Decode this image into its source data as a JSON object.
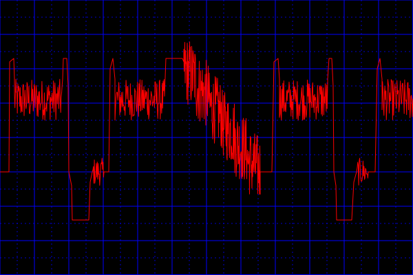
{
  "colors": {
    "background": "#000000",
    "grid_major": "#0000ff",
    "grid_minor": "#0000cc",
    "trace": "#ff0000"
  },
  "chart_data": {
    "type": "line",
    "title": "",
    "xlabel": "",
    "ylabel": "",
    "xlim": [
      0,
      12
    ],
    "ylim": [
      -4,
      4
    ],
    "grid": {
      "major": true,
      "minor_dotted": true,
      "major_x_divisions": 12,
      "major_y_divisions": 8
    },
    "series": [
      {
        "segments": [
          {
            "kind": "line",
            "points": [
              [
                0,
                -1.0
              ],
              [
                0.26,
                -1.0
              ],
              [
                0.28,
                2.2
              ],
              [
                0.4,
                2.3
              ],
              [
                0.42,
                1.7
              ]
            ]
          },
          {
            "kind": "noise",
            "x": [
              0.42,
              1.82
            ],
            "center": 1.1,
            "amp": 0.6
          },
          {
            "kind": "line",
            "points": [
              [
                1.82,
                1.7
              ],
              [
                1.84,
                2.3
              ],
              [
                1.94,
                2.3
              ],
              [
                1.98,
                1.5
              ],
              [
                2.0,
                -1.0
              ],
              [
                2.08,
                -1.4
              ],
              [
                2.1,
                -2.4
              ],
              [
                2.58,
                -2.4
              ],
              [
                2.62,
                -1.3
              ],
              [
                2.68,
                -1.0
              ]
            ]
          },
          {
            "kind": "noise",
            "x": [
              2.7,
              3.02
            ],
            "center": -1.0,
            "amp": 0.4
          },
          {
            "kind": "line",
            "points": [
              [
                3.02,
                -1.0
              ],
              [
                3.16,
                -1.0
              ],
              [
                3.2,
                2.0
              ],
              [
                3.28,
                2.3
              ],
              [
                3.34,
                1.7
              ]
            ]
          },
          {
            "kind": "noise",
            "x": [
              3.34,
              4.78
            ],
            "center": 1.1,
            "amp": 0.6
          },
          {
            "kind": "line",
            "points": [
              [
                4.78,
                1.2
              ],
              [
                4.82,
                2.3
              ],
              [
                5.3,
                2.3
              ],
              [
                5.34,
                2.2
              ]
            ]
          },
          {
            "kind": "ramp",
            "x": [
              5.34,
              7.56
            ],
            "y": [
              2.0,
              -1.2
            ],
            "amp": 1.0
          },
          {
            "kind": "line",
            "points": [
              [
                7.56,
                -1.0
              ],
              [
                7.9,
                -1.0
              ],
              [
                7.96,
                2.2
              ],
              [
                8.08,
                2.3
              ],
              [
                8.12,
                1.7
              ]
            ]
          },
          {
            "kind": "noise",
            "x": [
              8.12,
              9.52
            ],
            "center": 1.1,
            "amp": 0.6
          },
          {
            "kind": "line",
            "points": [
              [
                9.52,
                1.7
              ],
              [
                9.56,
                2.3
              ],
              [
                9.64,
                2.3
              ],
              [
                9.68,
                1.5
              ],
              [
                9.7,
                -1.0
              ],
              [
                9.76,
                -1.4
              ],
              [
                9.78,
                -2.4
              ],
              [
                10.22,
                -2.4
              ],
              [
                10.28,
                -1.3
              ],
              [
                10.36,
                -1.0
              ]
            ]
          },
          {
            "kind": "noise",
            "x": [
              10.38,
              10.7
            ],
            "center": -1.0,
            "amp": 0.4
          },
          {
            "kind": "line",
            "points": [
              [
                10.7,
                -1.0
              ],
              [
                10.9,
                -1.0
              ],
              [
                10.96,
                2.0
              ],
              [
                11.04,
                2.3
              ],
              [
                11.1,
                1.7
              ]
            ]
          },
          {
            "kind": "noise",
            "x": [
              11.1,
              12.0
            ],
            "center": 1.1,
            "amp": 0.6
          }
        ]
      }
    ]
  }
}
